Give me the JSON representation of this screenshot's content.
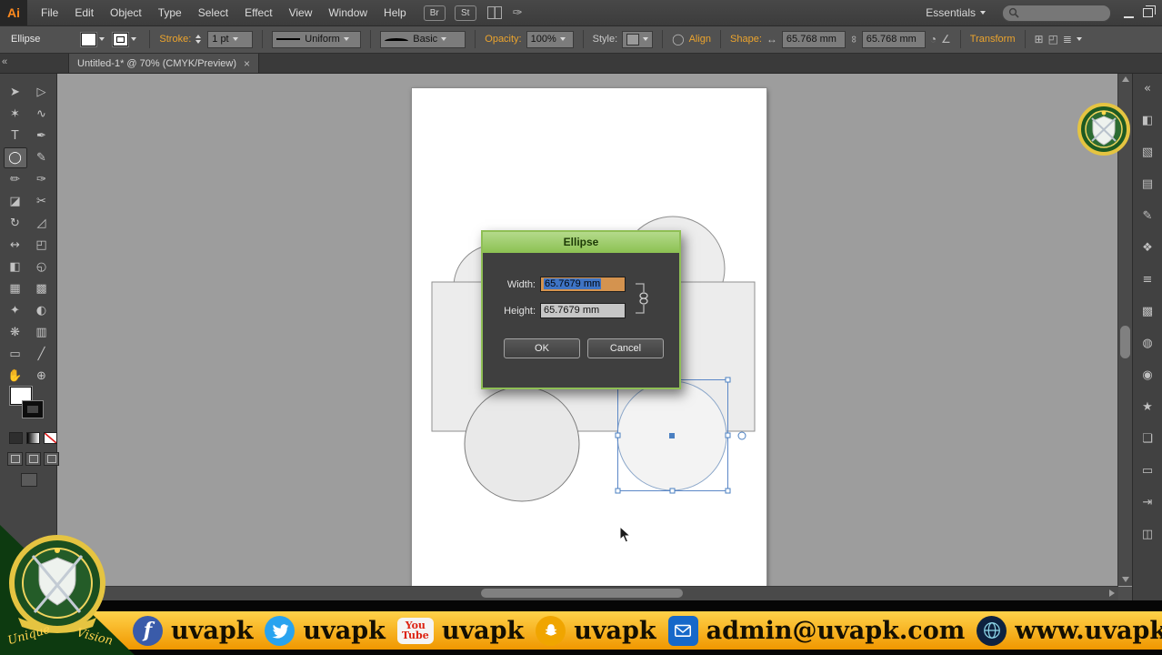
{
  "menubar": {
    "logo": "Ai",
    "items": [
      "File",
      "Edit",
      "Object",
      "Type",
      "Select",
      "Effect",
      "View",
      "Window",
      "Help"
    ],
    "bridge": "Br",
    "stock": "St",
    "workspace_icon": "✑",
    "workspace": "Essentials"
  },
  "controlbar": {
    "tool_label": "Ellipse",
    "stroke_label": "Stroke:",
    "stroke_value": "1 pt",
    "profile_value": "Uniform",
    "brush_value": "Basic",
    "opacity_label": "Opacity:",
    "opacity_value": "100%",
    "style_label": "Style:",
    "align_label": "Align",
    "shape_label": "Shape:",
    "shape_width": "65.768 mm",
    "shape_height": "65.768 mm",
    "transform_label": "Transform",
    "icons": {
      "document_circle": "◯",
      "width_height": "↔",
      "chain": "∞",
      "pie": "◔",
      "angle": "∠",
      "grid": "⊞",
      "free_transform": "◰",
      "menu": "≣"
    }
  },
  "tabbar": {
    "collapse_icon": "«",
    "title": "Untitled-1* @ 70% (CMYK/Preview)",
    "close": "×"
  },
  "tools": [
    {
      "name": "selection",
      "glyph": "➤"
    },
    {
      "name": "direct-selection",
      "glyph": "▷"
    },
    {
      "name": "magic-wand",
      "glyph": "✶"
    },
    {
      "name": "lasso",
      "glyph": "∿"
    },
    {
      "name": "type",
      "glyph": "T"
    },
    {
      "name": "pen",
      "glyph": "✒"
    },
    {
      "name": "ellipse",
      "glyph": "◯",
      "selected": true
    },
    {
      "name": "paintbrush",
      "glyph": "✎"
    },
    {
      "name": "pencil",
      "glyph": "✏"
    },
    {
      "name": "blob-brush",
      "glyph": "✑"
    },
    {
      "name": "eraser",
      "glyph": "◪"
    },
    {
      "name": "scissors",
      "glyph": "✂"
    },
    {
      "name": "rotate",
      "glyph": "↻"
    },
    {
      "name": "scale",
      "glyph": "◿"
    },
    {
      "name": "width",
      "glyph": "↔"
    },
    {
      "name": "free-transform",
      "glyph": "◰"
    },
    {
      "name": "shape-builder",
      "glyph": "◧"
    },
    {
      "name": "perspective-grid",
      "glyph": "◵"
    },
    {
      "name": "mesh",
      "glyph": "▦"
    },
    {
      "name": "gradient",
      "glyph": "▩"
    },
    {
      "name": "eyedropper",
      "glyph": "✦"
    },
    {
      "name": "blend",
      "glyph": "◐"
    },
    {
      "name": "symbol-sprayer",
      "glyph": "❋"
    },
    {
      "name": "column-graph",
      "glyph": "▥"
    },
    {
      "name": "artboard",
      "glyph": "▭"
    },
    {
      "name": "slice",
      "glyph": "╱"
    },
    {
      "name": "hand",
      "glyph": "✋"
    },
    {
      "name": "zoom",
      "glyph": "⊕"
    }
  ],
  "panels": [
    {
      "name": "collapse-panels",
      "glyph": "«"
    },
    {
      "name": "color",
      "glyph": "◧"
    },
    {
      "name": "color-guide",
      "glyph": "▧"
    },
    {
      "name": "swatches",
      "glyph": "▤"
    },
    {
      "name": "brushes",
      "glyph": "✎"
    },
    {
      "name": "symbols",
      "glyph": "❖"
    },
    {
      "name": "stroke",
      "glyph": "≡"
    },
    {
      "name": "gradient",
      "glyph": "▩"
    },
    {
      "name": "transparency",
      "glyph": "◍"
    },
    {
      "name": "appearance",
      "glyph": "◉"
    },
    {
      "name": "graphic-styles",
      "glyph": "★"
    },
    {
      "name": "layers",
      "glyph": "❏"
    },
    {
      "name": "artboards",
      "glyph": "▭"
    },
    {
      "name": "align",
      "glyph": "⇥"
    },
    {
      "name": "pathfinder",
      "glyph": "◫"
    }
  ],
  "dialog": {
    "title": "Ellipse",
    "width_label": "Width:",
    "width_value": "65.7679 mm",
    "height_label": "Height:",
    "height_value": "65.7679 mm",
    "ok": "OK",
    "cancel": "Cancel"
  },
  "footer": {
    "youtube_wordmark1": "You",
    "youtube_wordmark2": "Tube",
    "items": [
      {
        "name": "facebook",
        "text": "uvapk"
      },
      {
        "name": "twitter",
        "text": "uvapk"
      },
      {
        "name": "youtube",
        "text": "uvapk"
      },
      {
        "name": "snapchat",
        "text": "uvapk"
      },
      {
        "name": "email",
        "text": "admin@uvapk.com"
      },
      {
        "name": "website",
        "text": "www.uvapk.com"
      }
    ]
  },
  "logo_badge": {
    "word1": "Unique",
    "word2": "Vision"
  },
  "colors": {
    "accent_orange": "#eca42d",
    "dialog_green": "#8fbf55",
    "selection_blue": "#5b87c7",
    "footer_gold": "#f5a800"
  }
}
